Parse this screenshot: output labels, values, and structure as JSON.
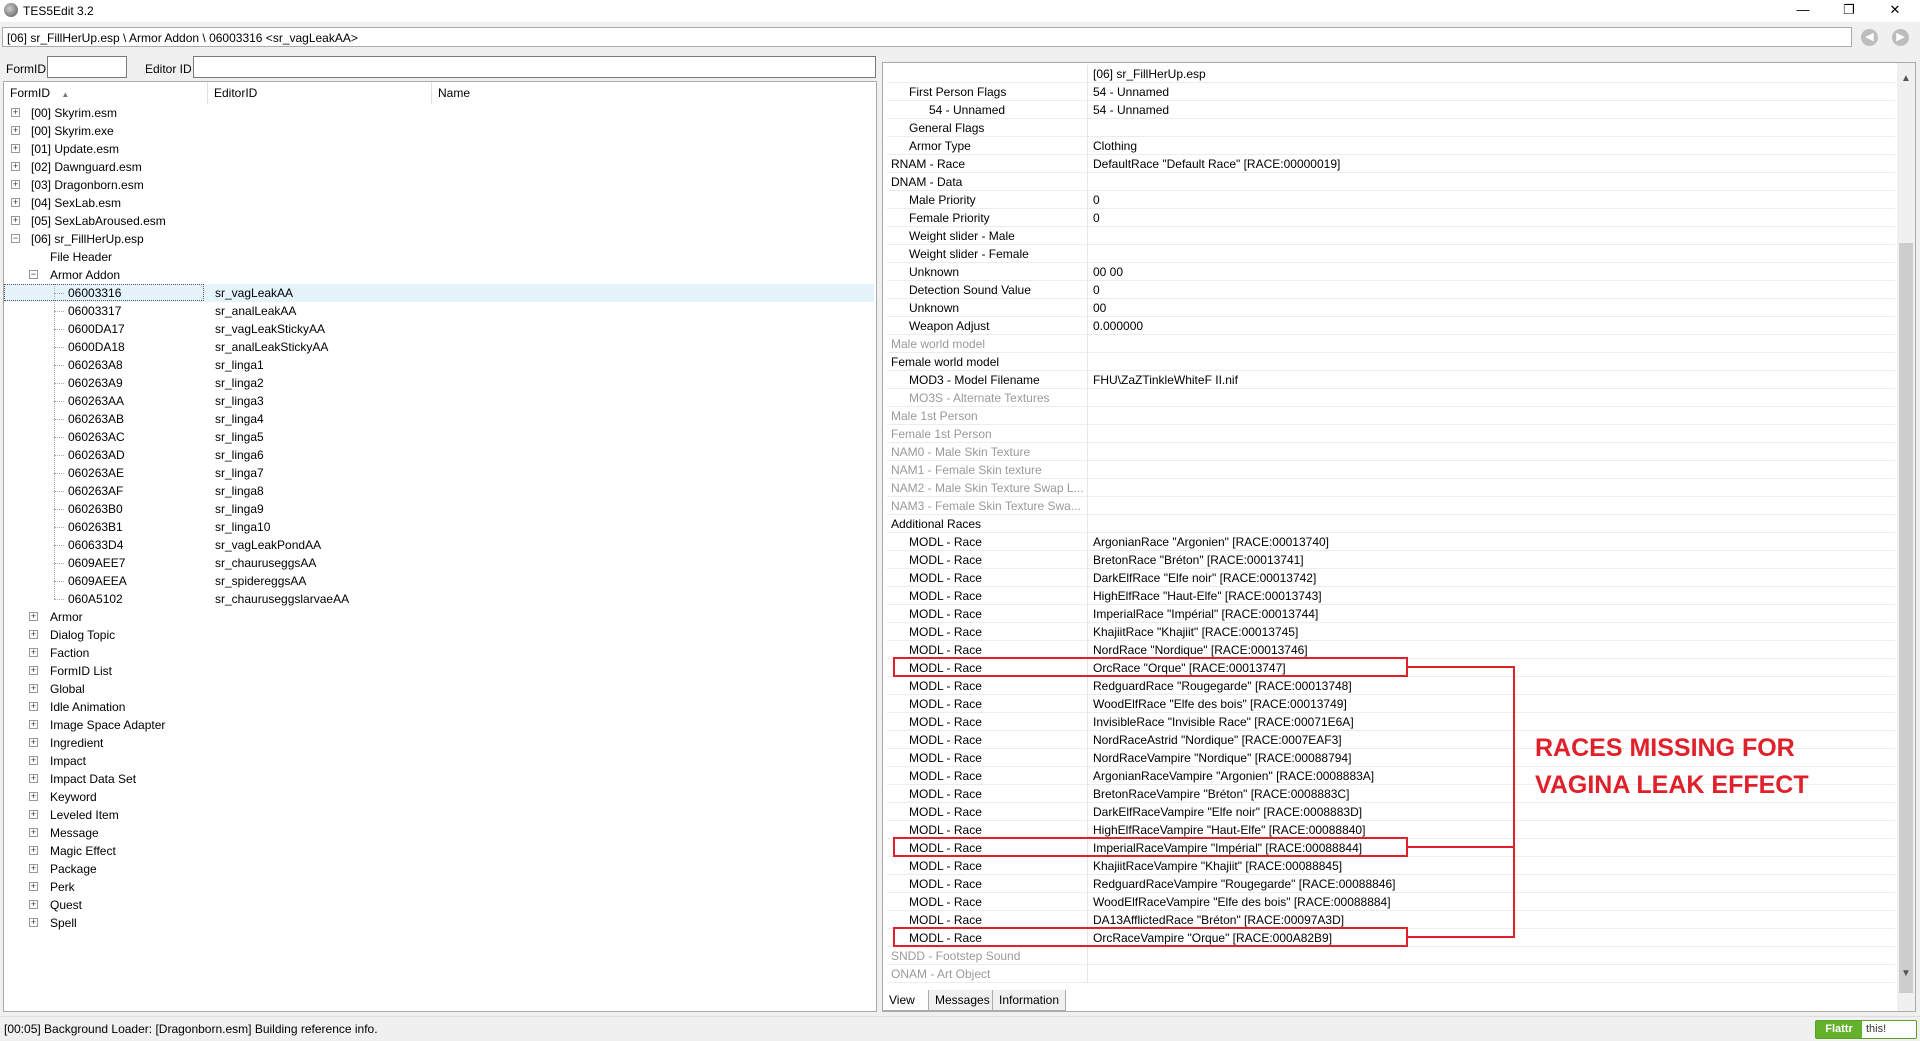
{
  "window": {
    "title": "TES5Edit 3.2",
    "min": "—",
    "restore": "❐",
    "close": "✕"
  },
  "path": "[06] sr_FillHerUp.esp \\ Armor Addon \\ 06003316 <sr_vagLeakAA>",
  "nav": {
    "back": "◀",
    "forward": "▶"
  },
  "filters": {
    "formid_label": "FormID",
    "editorid_label": "Editor ID",
    "formid_value": "",
    "editorid_value": ""
  },
  "left_pane": {
    "columns": [
      "FormID",
      "EditorID",
      "Name"
    ],
    "sort_indicator": "▲",
    "plugins": [
      {
        "label": "[00] Skyrim.esm"
      },
      {
        "label": "[00] Skyrim.exe"
      },
      {
        "label": "[01] Update.esm"
      },
      {
        "label": "[02] Dawnguard.esm"
      },
      {
        "label": "[03] Dragonborn.esm"
      },
      {
        "label": "[04] SexLab.esm"
      },
      {
        "label": "[05] SexLabAroused.esm"
      },
      {
        "label": "[06] sr_FillHerUp.esp"
      }
    ],
    "file_header": "File Header",
    "armor_addon": "Armor Addon",
    "records": [
      {
        "formid": "06003316",
        "editorid": "sr_vagLeakAA"
      },
      {
        "formid": "06003317",
        "editorid": "sr_analLeakAA"
      },
      {
        "formid": "0600DA17",
        "editorid": "sr_vagLeakStickyAA"
      },
      {
        "formid": "0600DA18",
        "editorid": "sr_analLeakStickyAA"
      },
      {
        "formid": "060263A8",
        "editorid": "sr_linga1"
      },
      {
        "formid": "060263A9",
        "editorid": "sr_linga2"
      },
      {
        "formid": "060263AA",
        "editorid": "sr_linga3"
      },
      {
        "formid": "060263AB",
        "editorid": "sr_linga4"
      },
      {
        "formid": "060263AC",
        "editorid": "sr_linga5"
      },
      {
        "formid": "060263AD",
        "editorid": "sr_linga6"
      },
      {
        "formid": "060263AE",
        "editorid": "sr_linga7"
      },
      {
        "formid": "060263AF",
        "editorid": "sr_linga8"
      },
      {
        "formid": "060263B0",
        "editorid": "sr_linga9"
      },
      {
        "formid": "060263B1",
        "editorid": "sr_linga10"
      },
      {
        "formid": "060633D4",
        "editorid": "sr_vagLeakPondAA"
      },
      {
        "formid": "0609AEE7",
        "editorid": "sr_chauruseggsAA"
      },
      {
        "formid": "0609AEEA",
        "editorid": "sr_spidereggsAA"
      },
      {
        "formid": "060A5102",
        "editorid": "sr_chauruseggslarvaeAA"
      }
    ],
    "groups": [
      "Armor",
      "Dialog Topic",
      "Faction",
      "FormID List",
      "Global",
      "Idle Animation",
      "Image Space Adapter",
      "Ingredient",
      "Impact",
      "Impact Data Set",
      "Keyword",
      "Leveled Item",
      "Message",
      "Magic Effect",
      "Package",
      "Perk",
      "Quest",
      "Spell"
    ]
  },
  "right_pane": {
    "rows": [
      {
        "name": "",
        "value": "[06] sr_FillHerUp.esp",
        "indent": 0,
        "dim": false
      },
      {
        "name": "First Person Flags",
        "value": "54 - Unnamed",
        "indent": 1,
        "dim": false
      },
      {
        "name": "54 - Unnamed",
        "value": "54 - Unnamed",
        "indent": 2,
        "dim": false
      },
      {
        "name": "General Flags",
        "value": "",
        "indent": 1,
        "dim": false
      },
      {
        "name": "Armor Type",
        "value": "Clothing",
        "indent": 1,
        "dim": false
      },
      {
        "name": "RNAM - Race",
        "value": "DefaultRace \"Default Race\" [RACE:00000019]",
        "indent": 0,
        "dim": false
      },
      {
        "name": "DNAM - Data",
        "value": "",
        "indent": 0,
        "dim": false
      },
      {
        "name": "Male Priority",
        "value": "0",
        "indent": 1,
        "dim": false
      },
      {
        "name": "Female Priority",
        "value": "0",
        "indent": 1,
        "dim": false
      },
      {
        "name": "Weight slider - Male",
        "value": "",
        "indent": 1,
        "dim": false
      },
      {
        "name": "Weight slider - Female",
        "value": "",
        "indent": 1,
        "dim": false
      },
      {
        "name": "Unknown",
        "value": "00 00",
        "indent": 1,
        "dim": false
      },
      {
        "name": "Detection Sound Value",
        "value": "0",
        "indent": 1,
        "dim": false
      },
      {
        "name": "Unknown",
        "value": "00",
        "indent": 1,
        "dim": false
      },
      {
        "name": "Weapon Adjust",
        "value": "0.000000",
        "indent": 1,
        "dim": false
      },
      {
        "name": "Male world model",
        "value": "",
        "indent": 0,
        "dim": true
      },
      {
        "name": "Female world model",
        "value": "",
        "indent": 0,
        "dim": false
      },
      {
        "name": "MOD3 - Model Filename",
        "value": "FHU\\ZaZTinkleWhiteF II.nif",
        "indent": 1,
        "dim": false
      },
      {
        "name": "MO3S - Alternate Textures",
        "value": "",
        "indent": 1,
        "dim": true
      },
      {
        "name": "Male 1st Person",
        "value": "",
        "indent": 0,
        "dim": true
      },
      {
        "name": "Female 1st Person",
        "value": "",
        "indent": 0,
        "dim": true
      },
      {
        "name": "NAM0 - Male Skin Texture",
        "value": "",
        "indent": 0,
        "dim": true
      },
      {
        "name": "NAM1 - Female Skin texture",
        "value": "",
        "indent": 0,
        "dim": true
      },
      {
        "name": "NAM2 - Male Skin Texture Swap L...",
        "value": "",
        "indent": 0,
        "dim": true
      },
      {
        "name": "NAM3 - Female Skin Texture Swa...",
        "value": "",
        "indent": 0,
        "dim": true
      },
      {
        "name": "Additional Races",
        "value": "",
        "indent": 0,
        "dim": false
      },
      {
        "name": "MODL - Race",
        "value": "ArgonianRace \"Argonien\" [RACE:00013740]",
        "indent": 1,
        "dim": false
      },
      {
        "name": "MODL - Race",
        "value": "BretonRace \"Bréton\" [RACE:00013741]",
        "indent": 1,
        "dim": false
      },
      {
        "name": "MODL - Race",
        "value": "DarkElfRace \"Elfe noir\" [RACE:00013742]",
        "indent": 1,
        "dim": false
      },
      {
        "name": "MODL - Race",
        "value": "HighElfRace \"Haut-Elfe\" [RACE:00013743]",
        "indent": 1,
        "dim": false
      },
      {
        "name": "MODL - Race",
        "value": "ImperialRace \"Impérial\" [RACE:00013744]",
        "indent": 1,
        "dim": false
      },
      {
        "name": "MODL - Race",
        "value": "KhajiitRace \"Khajiit\" [RACE:00013745]",
        "indent": 1,
        "dim": false
      },
      {
        "name": "MODL - Race",
        "value": "NordRace \"Nordique\" [RACE:00013746]",
        "indent": 1,
        "dim": false
      },
      {
        "name": "MODL - Race",
        "value": "OrcRace \"Orque\" [RACE:00013747]",
        "indent": 1,
        "dim": false
      },
      {
        "name": "MODL - Race",
        "value": "RedguardRace \"Rougegarde\" [RACE:00013748]",
        "indent": 1,
        "dim": false
      },
      {
        "name": "MODL - Race",
        "value": "WoodElfRace \"Elfe des bois\" [RACE:00013749]",
        "indent": 1,
        "dim": false
      },
      {
        "name": "MODL - Race",
        "value": "InvisibleRace \"Invisible Race\" [RACE:00071E6A]",
        "indent": 1,
        "dim": false
      },
      {
        "name": "MODL - Race",
        "value": "NordRaceAstrid \"Nordique\" [RACE:0007EAF3]",
        "indent": 1,
        "dim": false
      },
      {
        "name": "MODL - Race",
        "value": "NordRaceVampire \"Nordique\" [RACE:00088794]",
        "indent": 1,
        "dim": false
      },
      {
        "name": "MODL - Race",
        "value": "ArgonianRaceVampire \"Argonien\" [RACE:0008883A]",
        "indent": 1,
        "dim": false
      },
      {
        "name": "MODL - Race",
        "value": "BretonRaceVampire \"Bréton\" [RACE:0008883C]",
        "indent": 1,
        "dim": false
      },
      {
        "name": "MODL - Race",
        "value": "DarkElfRaceVampire \"Elfe noir\" [RACE:0008883D]",
        "indent": 1,
        "dim": false
      },
      {
        "name": "MODL - Race",
        "value": "HighElfRaceVampire \"Haut-Elfe\" [RACE:00088840]",
        "indent": 1,
        "dim": false
      },
      {
        "name": "MODL - Race",
        "value": "ImperialRaceVampire \"Impérial\" [RACE:00088844]",
        "indent": 1,
        "dim": false
      },
      {
        "name": "MODL - Race",
        "value": "KhajiitRaceVampire \"Khajiit\" [RACE:00088845]",
        "indent": 1,
        "dim": false
      },
      {
        "name": "MODL - Race",
        "value": "RedguardRaceVampire \"Rougegarde\" [RACE:00088846]",
        "indent": 1,
        "dim": false
      },
      {
        "name": "MODL - Race",
        "value": "WoodElfRaceVampire \"Elfe des bois\" [RACE:00088884]",
        "indent": 1,
        "dim": false
      },
      {
        "name": "MODL - Race",
        "value": "DA13AfflictedRace \"Bréton\" [RACE:00097A3D]",
        "indent": 1,
        "dim": false
      },
      {
        "name": "MODL - Race",
        "value": "OrcRaceVampire \"Orque\" [RACE:000A82B9]",
        "indent": 1,
        "dim": false
      },
      {
        "name": "SNDD - Footstep Sound",
        "value": "",
        "indent": 0,
        "dim": true
      },
      {
        "name": "ONAM - Art Object",
        "value": "",
        "indent": 0,
        "dim": true
      }
    ],
    "scroll_up": "▲",
    "scroll_down": "▼"
  },
  "annotation": {
    "line1": "RACES MISSING FOR",
    "line2": "VAGINA LEAK EFFECT",
    "color": "#e0202a"
  },
  "bottom_tabs": [
    "View",
    "Messages",
    "Information"
  ],
  "status": {
    "text": "[00:05] Background Loader: [Dragonborn.esm] Building reference info."
  },
  "flattr": {
    "label": "Flattr",
    "suffix": "this!"
  }
}
